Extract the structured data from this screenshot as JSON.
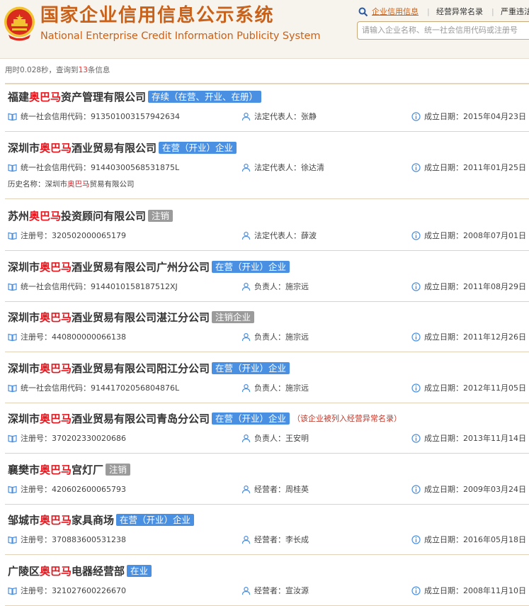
{
  "header": {
    "title_cn": "国家企业信用信息公示系统",
    "title_en": "National Enterprise Credit Information Publicity System",
    "tabs": [
      {
        "label": "企业信用信息",
        "active": true
      },
      {
        "label": "经营异常名录",
        "active": false
      },
      {
        "label": "严重违法",
        "active": false
      }
    ],
    "search_placeholder": "请输入企业名称、统一社会信用代码或注册号",
    "colors": {
      "brand": "#c8611a",
      "header_bg": "#f7f4ee",
      "highlight": "#e8151d",
      "badge_blue": "#4a90e2",
      "badge_gray": "#9b9b9b"
    }
  },
  "stats": {
    "prefix": "用时0.028秒，查询到",
    "count": "13",
    "suffix": "条信息"
  },
  "results": [
    {
      "pre": "福建",
      "hl": "奥巴马",
      "post": "资产管理有限公司",
      "badge": "存续（在营、开业、在册）",
      "badge_style": "blue",
      "code_label": "统一社会信用代码：",
      "code": "913501003157942634",
      "rep_label": "法定代表人：",
      "rep": "张静",
      "date_label": "成立日期：",
      "date": "2015年04月23日"
    },
    {
      "pre": "深圳市",
      "hl": "奥巴马",
      "post": "酒业贸易有限公司",
      "badge": "在营（开业）企业",
      "badge_style": "blue",
      "code_label": "统一社会信用代码：",
      "code": "91440300568531875L",
      "rep_label": "法定代表人：",
      "rep": "徐达清",
      "date_label": "成立日期：",
      "date": "2011年01月25日",
      "history_label": "历史名称：",
      "history_pre": "深圳市",
      "history_hl": "奥巴马",
      "history_post": "贸易有限公司"
    },
    {
      "pre": "苏州",
      "hl": "奥巴马",
      "post": "投资顾问有限公司",
      "badge": "注销",
      "badge_style": "gray",
      "code_label": "注册号：",
      "code": "320502000065179",
      "rep_label": "法定代表人：",
      "rep": "薛波",
      "date_label": "成立日期：",
      "date": "2008年07月01日"
    },
    {
      "pre": "深圳市",
      "hl": "奥巴马",
      "post": "酒业贸易有限公司广州分公司",
      "badge": "在营（开业）企业",
      "badge_style": "blue",
      "code_label": "统一社会信用代码：",
      "code": "9144010158187512XJ",
      "rep_label": "负责人：",
      "rep": "施宗远",
      "date_label": "成立日期：",
      "date": "2011年08月29日"
    },
    {
      "pre": "深圳市",
      "hl": "奥巴马",
      "post": "酒业贸易有限公司湛江分公司",
      "badge": "注销企业",
      "badge_style": "gray",
      "code_label": "注册号：",
      "code": "440800000066138",
      "rep_label": "负责人：",
      "rep": "施宗远",
      "date_label": "成立日期：",
      "date": "2011年12月26日"
    },
    {
      "pre": "深圳市",
      "hl": "奥巴马",
      "post": "酒业贸易有限公司阳江分公司",
      "badge": "在营（开业）企业",
      "badge_style": "blue",
      "code_label": "统一社会信用代码：",
      "code": "91441702056804876L",
      "rep_label": "负责人：",
      "rep": "施宗远",
      "date_label": "成立日期：",
      "date": "2012年11月05日"
    },
    {
      "pre": "深圳市",
      "hl": "奥巴马",
      "post": "酒业贸易有限公司青岛分公司",
      "badge": "在营（开业）企业",
      "badge_style": "blue",
      "abnormal": "（该企业被列入经营异常名录）",
      "code_label": "注册号：",
      "code": "370202330020686",
      "rep_label": "负责人：",
      "rep": "王安明",
      "date_label": "成立日期：",
      "date": "2013年11月14日"
    },
    {
      "pre": "襄樊市",
      "hl": "奥巴马",
      "post": "宫灯厂",
      "badge": "注销",
      "badge_style": "gray",
      "code_label": "注册号：",
      "code": "420602600065793",
      "rep_label": "经营者：",
      "rep": "周桂英",
      "date_label": "成立日期：",
      "date": "2009年03月24日"
    },
    {
      "pre": "邹城市",
      "hl": "奥巴马",
      "post": "家具商场",
      "badge": "在营（开业）企业",
      "badge_style": "blue",
      "code_label": "注册号：",
      "code": "370883600531238",
      "rep_label": "经营者：",
      "rep": "李长成",
      "date_label": "成立日期：",
      "date": "2016年05月18日"
    },
    {
      "pre": "广陵区",
      "hl": "奥巴马",
      "post": "电器经营部",
      "badge": "在业",
      "badge_style": "blue",
      "code_label": "注册号：",
      "code": "321027600226670",
      "rep_label": "经营者：",
      "rep": "宣汝源",
      "date_label": "成立日期：",
      "date": "2008年11月10日"
    }
  ]
}
